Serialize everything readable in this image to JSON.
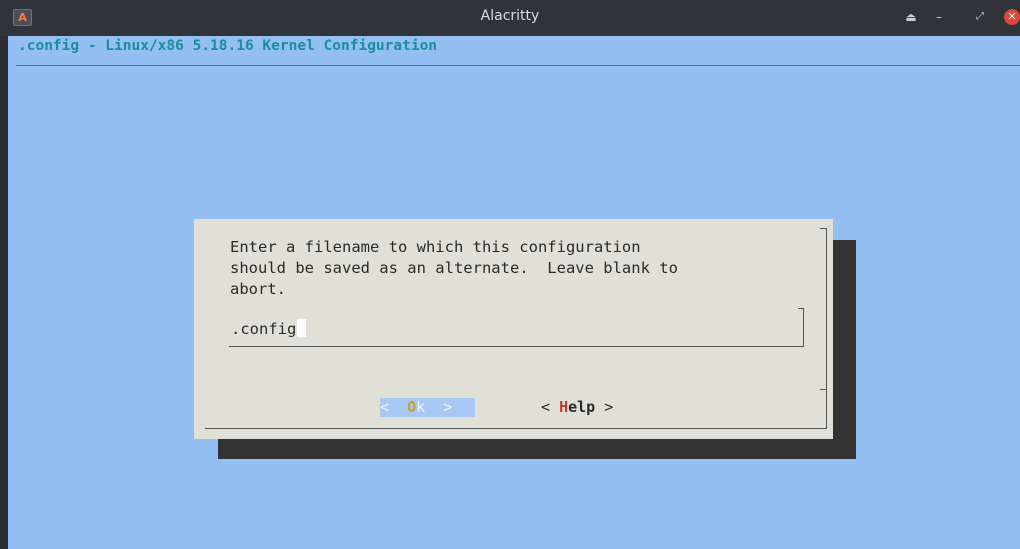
{
  "window": {
    "title": "Alacritty",
    "icon": "alacritty-icon",
    "controls": [
      "eject-icon",
      "minimize-icon",
      "restore-icon",
      "close-icon"
    ]
  },
  "terminal": {
    "heading": ".config - Linux/x86 5.18.16 Kernel Configuration"
  },
  "dialog": {
    "prompt": "Enter a filename to which this configuration\nshould be saved as an alternate.  Leave blank to\nabort.",
    "input_value": ".config",
    "ok_button": {
      "left": "<  ",
      "hotkey": "O",
      "rest": "k",
      "right": "  >"
    },
    "help_button": {
      "left": "< ",
      "hotkey": "H",
      "rest": "elp",
      "right": " >"
    }
  },
  "colors": {
    "terminal_bg": "#94bff2",
    "heading": "#1a8f9a",
    "dialog_bg": "#e1e0d6",
    "selected_button_bg": "#a7c8f2",
    "hotkey_selected": "#c9a033",
    "hotkey": "#c0392b"
  }
}
